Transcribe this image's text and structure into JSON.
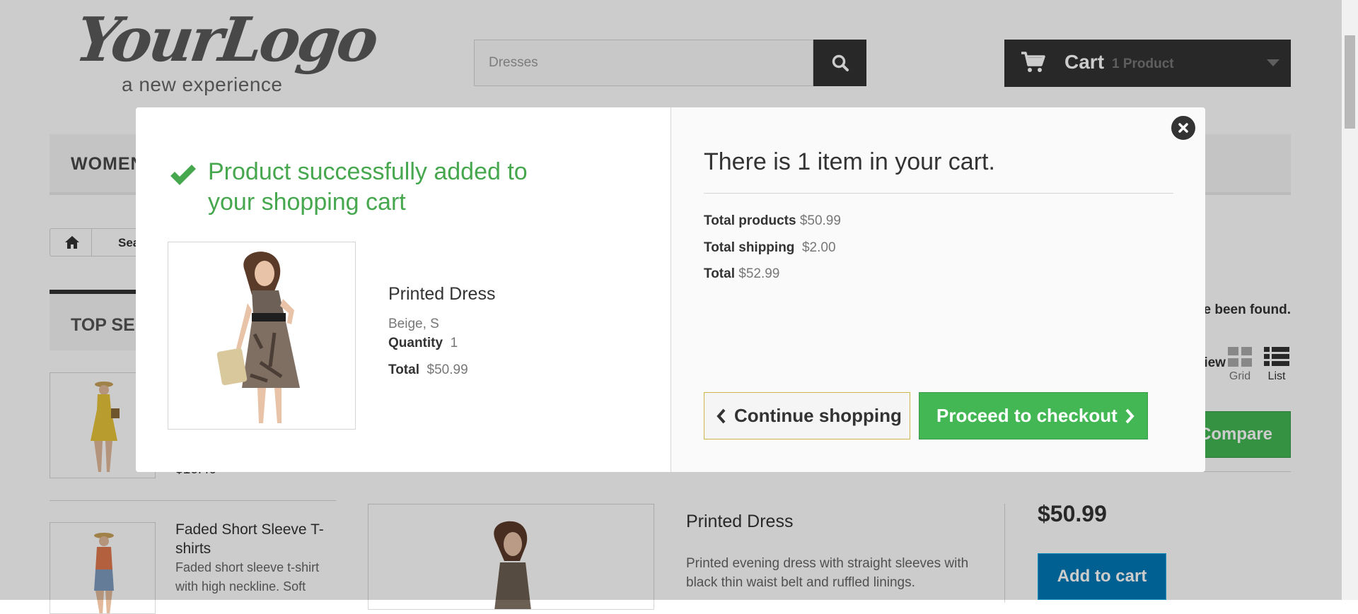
{
  "header": {
    "logo_main": "YourLogo",
    "logo_sub": "a new experience",
    "search_placeholder": "Dresses",
    "cart_label": "Cart",
    "cart_count": "1 Product"
  },
  "nav": {
    "first_item": "WOMEN"
  },
  "breadcrumb": {
    "current": "Search"
  },
  "sidebar": {
    "block_title": "TOP SELLERS",
    "price_fragment": "$16.40",
    "item2_title": "Faded Short Sleeve T-shirts",
    "item2_desc": "Faded short sleeve t-shirt with high neckline. Soft"
  },
  "listing": {
    "found_text": "3 results have been found.",
    "view_label": "View",
    "grid_label": "Grid",
    "list_label": "List",
    "compare_label": "Compare (0)",
    "product_name": "Printed Dress",
    "product_desc": "Printed evening dress with straight sleeves with black thin waist belt and ruffled linings.",
    "product_price": "$50.99",
    "add_to_cart": "Add to cart"
  },
  "modal": {
    "success_message": "Product successfully added to your shopping cart",
    "product_name": "Printed Dress",
    "attributes": "Beige, S",
    "quantity_label": "Quantity",
    "quantity_value": "1",
    "total_label": "Total",
    "total_value": "$50.99",
    "cart_heading": "There is 1 item in your cart.",
    "total_products_label": "Total products",
    "total_products_value": "$50.99",
    "total_shipping_label": "Total shipping",
    "total_shipping_value": "$2.00",
    "grand_total_label": "Total",
    "grand_total_value": "$52.99",
    "continue_label": "Continue shopping",
    "checkout_label": "Proceed to checkout"
  },
  "colors": {
    "success_green": "#46a74e",
    "button_green": "#43b754",
    "dark": "#333333",
    "blue": "#0079b6"
  }
}
